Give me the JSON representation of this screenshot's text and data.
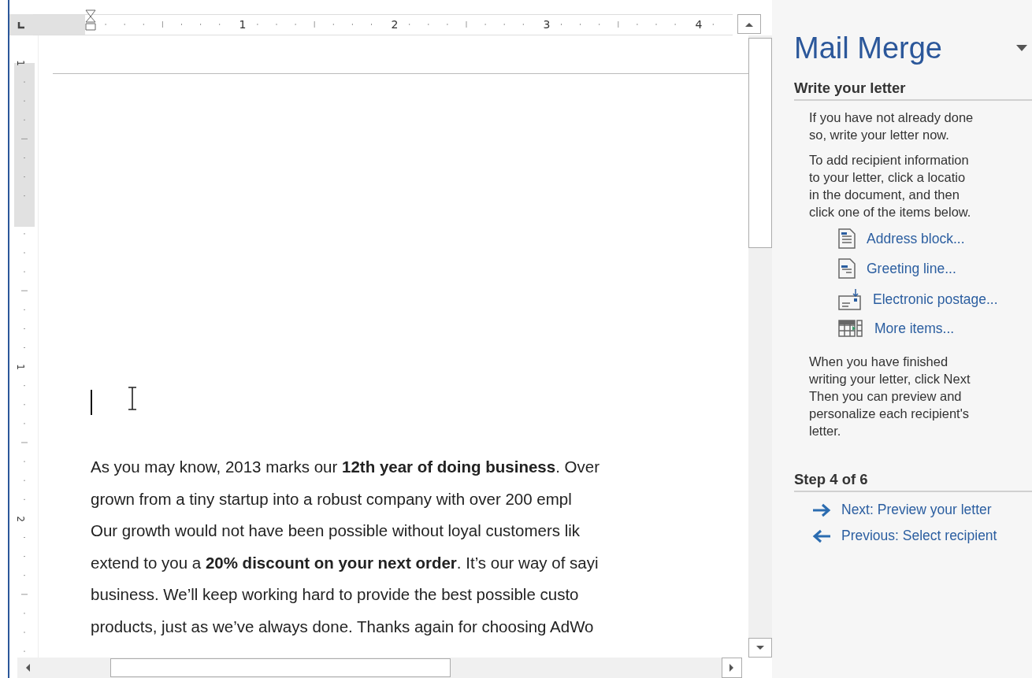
{
  "ruler": {
    "numbers": [
      "1",
      "2",
      "3",
      "4"
    ],
    "vertical_numbers": [
      "1",
      "1",
      "2"
    ]
  },
  "document": {
    "lines": [
      "As you may know, 2013 marks our **12th year of doing business**. Over",
      "grown from a tiny startup into a robust company with over 200 empl",
      "Our growth would not have been possible without loyal customers lik",
      "extend to you a **20% discount on your next order**. It’s our way of sayi",
      "business. We’ll keep working hard to provide the best possible custo",
      "products, just as we’ve always done. Thanks again for choosing AdWo"
    ]
  },
  "pane": {
    "title": "Mail Merge",
    "section_heading": "Write your letter",
    "paragraphs": [
      [
        "If you have not already done",
        "so, write your letter now."
      ],
      [
        "To add recipient information",
        "to your letter, click a locatio",
        "in the document, and then",
        "click one of the items below."
      ]
    ],
    "items": [
      {
        "kind": "address",
        "label": "Address block..."
      },
      {
        "kind": "greeting",
        "label": "Greeting line..."
      },
      {
        "kind": "postage",
        "label": "Electronic postage..."
      },
      {
        "kind": "more",
        "label": "More items..."
      }
    ],
    "closing_paragraph": [
      "When you have finished",
      "writing your letter, click Next",
      "Then you can preview and",
      "personalize each recipient's",
      "letter."
    ],
    "step_heading": "Step 4 of 6",
    "nav": [
      {
        "kind": "next",
        "label": "Next: Preview your letter"
      },
      {
        "kind": "previous",
        "label": "Previous: Select recipient"
      }
    ]
  }
}
